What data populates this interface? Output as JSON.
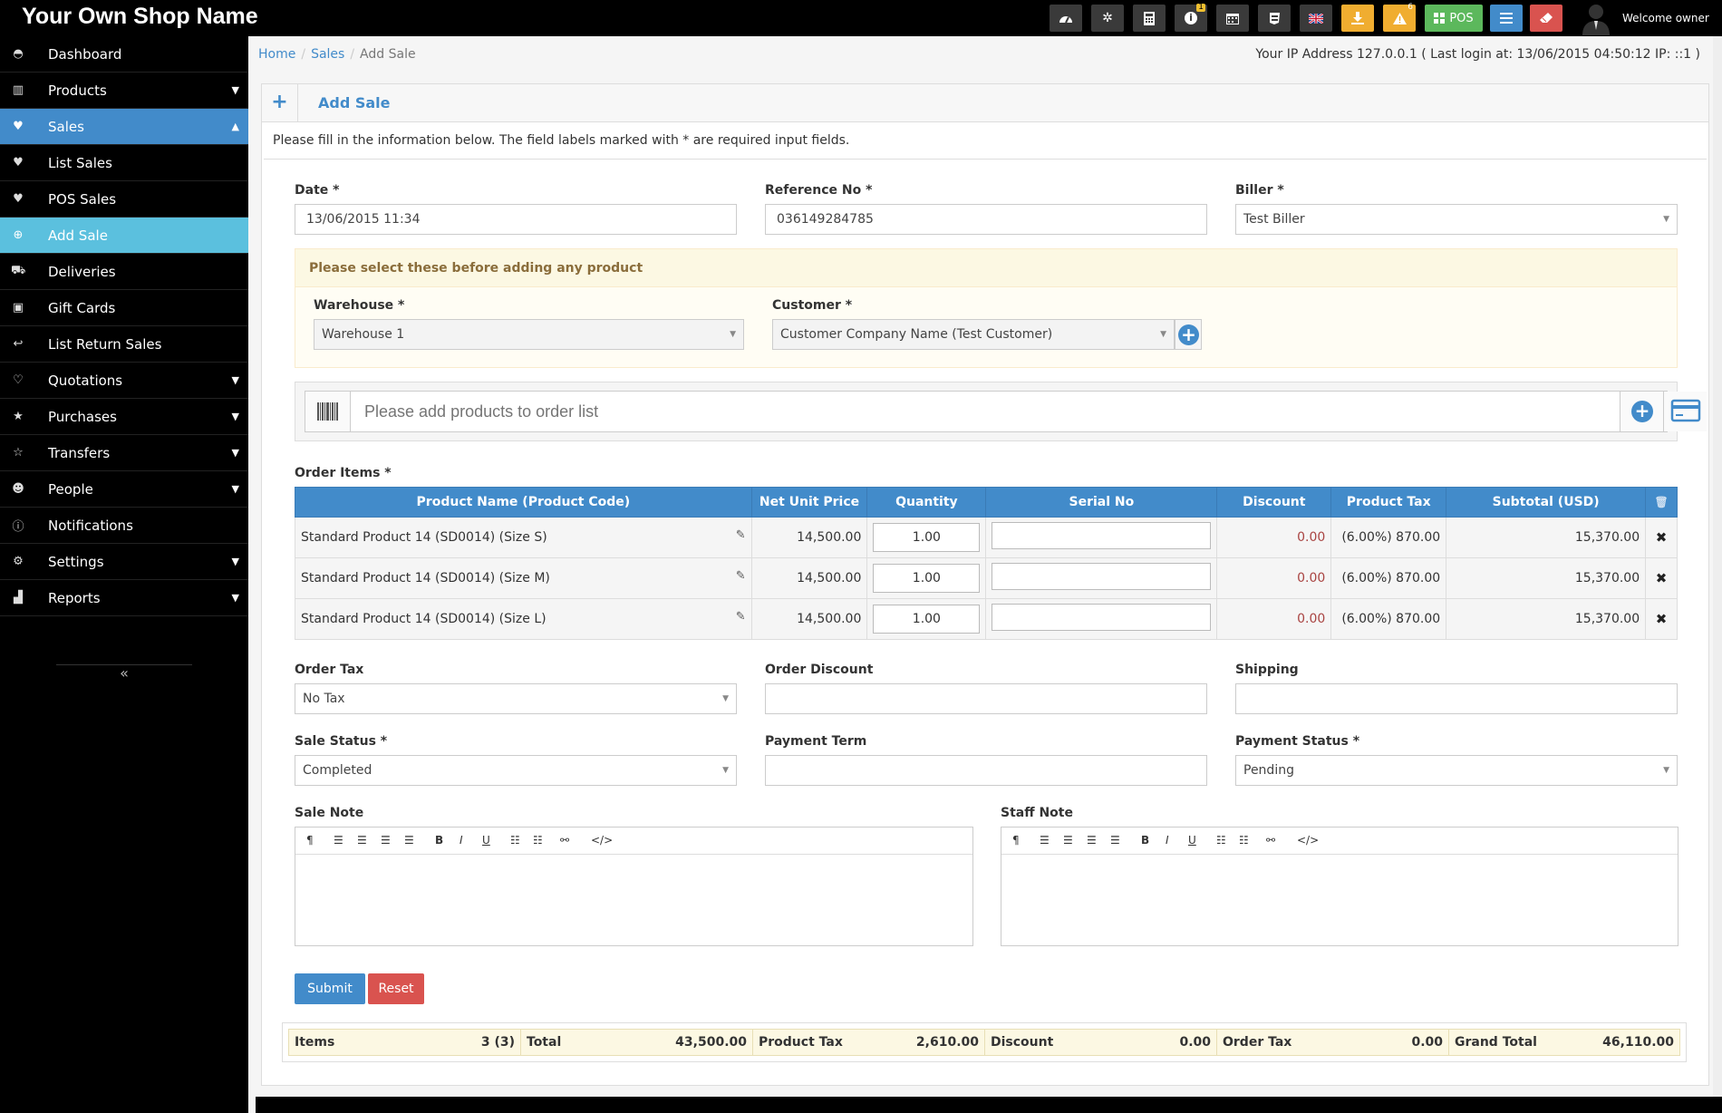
{
  "brand": "Your Own Shop Name",
  "topbar": {
    "counts": {
      "info": "1",
      "alerts": "6"
    },
    "pos_label": "POS",
    "welcome": "Welcome owner",
    "colors": {
      "yellow": "#f0ad30",
      "green": "#5cb85c",
      "blue": "#428bca",
      "red": "#d9534f"
    }
  },
  "sidebar": {
    "items": [
      {
        "label": "Dashboard",
        "icon": "dashboard-icon"
      },
      {
        "label": "Products",
        "icon": "barcode-icon"
      },
      {
        "label": "Sales",
        "icon": "heart-icon"
      },
      {
        "label": "List Sales",
        "icon": "heart-icon"
      },
      {
        "label": "POS Sales",
        "icon": "heart-icon"
      },
      {
        "label": "Add Sale",
        "icon": "plus-circle-icon"
      },
      {
        "label": "Deliveries",
        "icon": "truck-icon"
      },
      {
        "label": "Gift Cards",
        "icon": "gift-icon"
      },
      {
        "label": "List Return Sales",
        "icon": "reply-icon"
      },
      {
        "label": "Quotations",
        "icon": "heart-outline-icon"
      },
      {
        "label": "Purchases",
        "icon": "star-icon"
      },
      {
        "label": "Transfers",
        "icon": "star-outline-icon"
      },
      {
        "label": "People",
        "icon": "users-icon"
      },
      {
        "label": "Notifications",
        "icon": "info-icon"
      },
      {
        "label": "Settings",
        "icon": "cog-icon"
      },
      {
        "label": "Reports",
        "icon": "bar-chart-icon"
      }
    ]
  },
  "breadcrumb": {
    "home": "Home",
    "sales": "Sales",
    "current": "Add Sale"
  },
  "ip_info": "Your IP Address 127.0.0.1 ( Last login at: 13/06/2015 04:50:12 IP: ::1 )",
  "panel": {
    "title": "Add Sale",
    "intro": "Please fill in the information below. The field labels marked with * are required input fields."
  },
  "form": {
    "date_label": "Date *",
    "date_value": "13/06/2015 11:34",
    "ref_label": "Reference No *",
    "ref_value": "036149284785",
    "biller_label": "Biller *",
    "biller_value": "Test Biller",
    "notice": "Please select these before adding any product",
    "warehouse_label": "Warehouse *",
    "warehouse_value": "Warehouse 1",
    "customer_label": "Customer *",
    "customer_value": "Customer Company Name (Test Customer)",
    "search_placeholder": "Please add products to order list",
    "order_items_label": "Order Items *",
    "order_tax_label": "Order Tax",
    "order_tax_value": "No Tax",
    "order_discount_label": "Order Discount",
    "shipping_label": "Shipping",
    "sale_status_label": "Sale Status *",
    "sale_status_value": "Completed",
    "payment_term_label": "Payment Term",
    "payment_status_label": "Payment Status *",
    "payment_status_value": "Pending",
    "sale_note_label": "Sale Note",
    "staff_note_label": "Staff Note",
    "submit_label": "Submit",
    "reset_label": "Reset"
  },
  "table": {
    "headers": [
      "Product Name (Product Code)",
      "Net Unit Price",
      "Quantity",
      "Serial No",
      "Discount",
      "Product Tax",
      "Subtotal (USD)"
    ],
    "rows": [
      {
        "name": "Standard Product 14 (SD0014) (Size S)",
        "price": "14,500.00",
        "qty": "1.00",
        "discount": "0.00",
        "tax": "(6.00%) 870.00",
        "subtotal": "15,370.00"
      },
      {
        "name": "Standard Product 14 (SD0014) (Size M)",
        "price": "14,500.00",
        "qty": "1.00",
        "discount": "0.00",
        "tax": "(6.00%) 870.00",
        "subtotal": "15,370.00"
      },
      {
        "name": "Standard Product 14 (SD0014) (Size L)",
        "price": "14,500.00",
        "qty": "1.00",
        "discount": "0.00",
        "tax": "(6.00%) 870.00",
        "subtotal": "15,370.00"
      }
    ]
  },
  "totals": {
    "items_label": "Items",
    "items_value": "3 (3)",
    "total_label": "Total",
    "total_value": "43,500.00",
    "ptax_label": "Product Tax",
    "ptax_value": "2,610.00",
    "discount_label": "Discount",
    "discount_value": "0.00",
    "otax_label": "Order Tax",
    "otax_value": "0.00",
    "grand_label": "Grand Total",
    "grand_value": "46,110.00"
  }
}
